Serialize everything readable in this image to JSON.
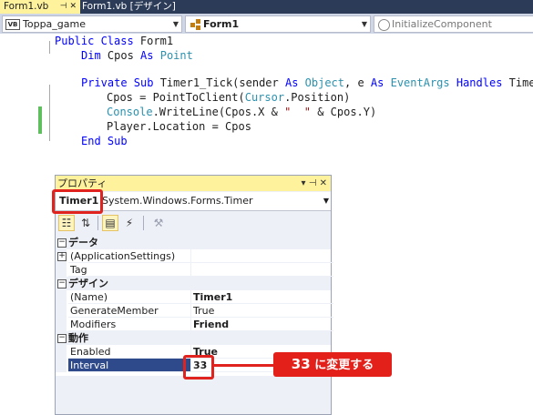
{
  "editor": {
    "tabs": [
      {
        "label": "Form1.vb",
        "pin": "⊣ ✕"
      },
      {
        "label": "Form1.vb [デザイン]"
      }
    ],
    "nav": {
      "project_icon": "VB",
      "project": "Toppa_game",
      "class": "Form1",
      "member": "InitializeComponent"
    },
    "code": {
      "l1_kw": "Public Class",
      "l1_name": " Form1",
      "l2_dim": "Dim",
      "l2_var": " Cpos ",
      "l2_as": "As",
      "l2_type": " Point",
      "l4_private": "Private Sub",
      "l4_sig": " Timer1_Tick(sender ",
      "l4_as1": "As",
      "l4_obj": " Object",
      "l4_mid": ", e ",
      "l4_as2": "As",
      "l4_evargs": " EventArgs",
      "l4_sp": " ",
      "l4_handles": "Handles",
      "l4_tail": " Time",
      "l5_a": "Cpos = PointToClient(",
      "l5_cursor": "Cursor",
      "l5_b": ".Position)",
      "l6_console": "Console",
      "l6_a": ".WriteLine(Cpos.X & ",
      "l6_str": "\"  \"",
      "l6_b": " & Cpos.Y)",
      "l7": "Player.Location = Cpos",
      "l8": "End Sub"
    }
  },
  "properties": {
    "title": "プロパティ",
    "title_buttons": "▾ ⊣ ✕",
    "object_name": "Timer1",
    "object_type": "System.Windows.Forms.Timer",
    "toolbar_icons": [
      "categorized-icon",
      "alphabetical-icon",
      "properties-icon",
      "events-icon",
      "property-pages-icon"
    ],
    "rows": [
      {
        "kind": "cat",
        "label": "データ",
        "expander": "−"
      },
      {
        "kind": "prop",
        "name": "(ApplicationSettings)",
        "value": "",
        "expander": "+"
      },
      {
        "kind": "prop",
        "name": "Tag",
        "value": ""
      },
      {
        "kind": "cat",
        "label": "デザイン",
        "expander": "−"
      },
      {
        "kind": "prop",
        "name": "(Name)",
        "value": "Timer1",
        "bold": true
      },
      {
        "kind": "prop",
        "name": "GenerateMember",
        "value": "True"
      },
      {
        "kind": "prop",
        "name": "Modifiers",
        "value": "Friend",
        "bold": true
      },
      {
        "kind": "cat",
        "label": "動作",
        "expander": "−"
      },
      {
        "kind": "prop",
        "name": "Enabled",
        "value": "True",
        "bold": true
      },
      {
        "kind": "prop",
        "name": "Interval",
        "value": "33",
        "bold": true,
        "selected": true
      }
    ]
  },
  "annotation": {
    "number": "33",
    "text": " に変更する",
    "color": "#e3201a"
  }
}
